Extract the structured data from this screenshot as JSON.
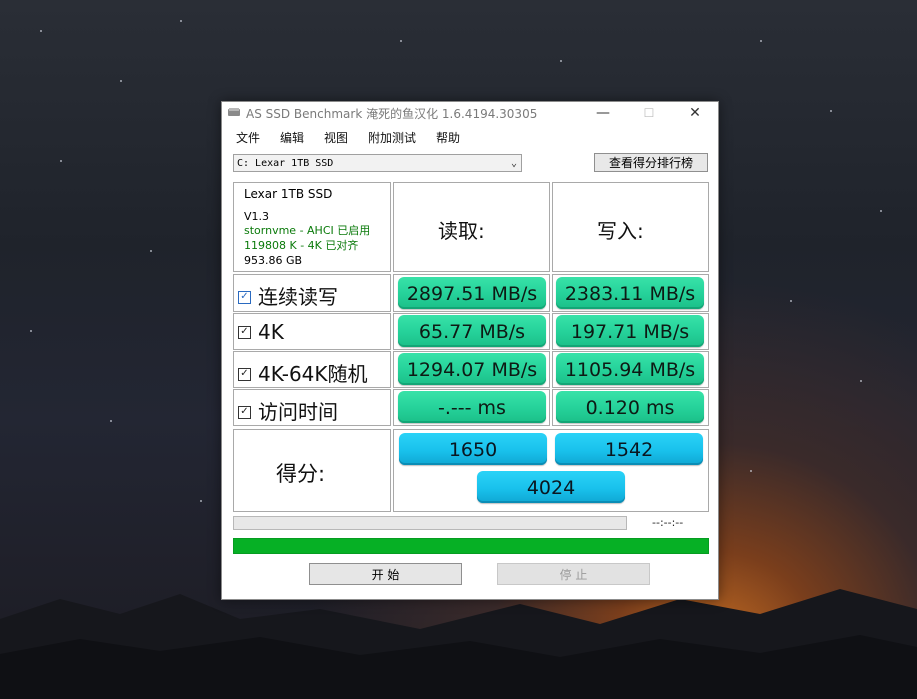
{
  "window": {
    "title": "AS SSD Benchmark 淹死的鱼汉化 1.6.4194.30305",
    "minimize": "—",
    "maximize": "☐",
    "close": "✕"
  },
  "menu": [
    "文件",
    "编辑",
    "视图",
    "附加测试",
    "帮助"
  ],
  "drive_select": {
    "value": "C: Lexar 1TB SSD"
  },
  "rank_button": "查看得分排行榜",
  "drive_info": {
    "name": "Lexar 1TB SSD",
    "firmware": "V1.3",
    "driver": "stornvme - AHCI 已启用",
    "alignment": "119808 K - 4K 已对齐",
    "capacity": "953.86 GB"
  },
  "headers": {
    "read": "读取:",
    "write": "写入:"
  },
  "rows": [
    {
      "label": "连续读写",
      "checked": true,
      "read": "2897.51 MB/s",
      "write": "2383.11 MB/s"
    },
    {
      "label": "4K",
      "checked": true,
      "read": "65.77 MB/s",
      "write": "197.71 MB/s"
    },
    {
      "label": "4K-64K随机",
      "checked": true,
      "read": "1294.07 MB/s",
      "write": "1105.94 MB/s"
    },
    {
      "label": "访问时间",
      "checked": true,
      "read": "-.--- ms",
      "write": "0.120 ms"
    }
  ],
  "score": {
    "label": "得分:",
    "read": "1650",
    "write": "1542",
    "total": "4024"
  },
  "progress": {
    "timer": "--:--:--",
    "top_bar_fraction": 0,
    "bottom_bar_fraction": 1
  },
  "buttons": {
    "start": "开 始",
    "stop": "停 止"
  },
  "colors": {
    "result_green": "#26d39b",
    "score_blue": "#19c1ec",
    "progress_green": "#06b025"
  }
}
